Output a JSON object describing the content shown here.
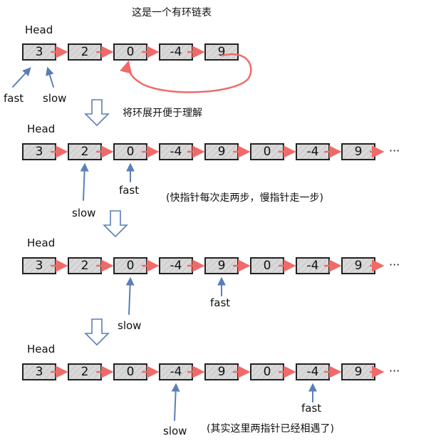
{
  "title": "这是一个有环链表",
  "head_label": "Head",
  "pointers": {
    "fast": "fast",
    "slow": "slow"
  },
  "notes": {
    "unroll": "将环展开便于理解",
    "speed": "(快指针每次走两步，慢指针走一步)",
    "meet": "(其实这里两指针已经相遇了)"
  },
  "ellipsis": "···",
  "cycle_list": [
    "3",
    "2",
    "0",
    "-4",
    "9"
  ],
  "unrolled_list": [
    "3",
    "2",
    "0",
    "-4",
    "9",
    "0",
    "-4",
    "9"
  ],
  "steps": [
    {
      "fast_index": 0,
      "slow_index": 0
    },
    {
      "fast_index": 2,
      "slow_index": 1
    },
    {
      "fast_index": 4,
      "slow_index": 2
    },
    {
      "fast_index": 6,
      "slow_index": 3
    }
  ],
  "colors": {
    "link": "#f06a6a",
    "pointer": "#5a7fb8",
    "node_fill": "#d9d9d9"
  }
}
